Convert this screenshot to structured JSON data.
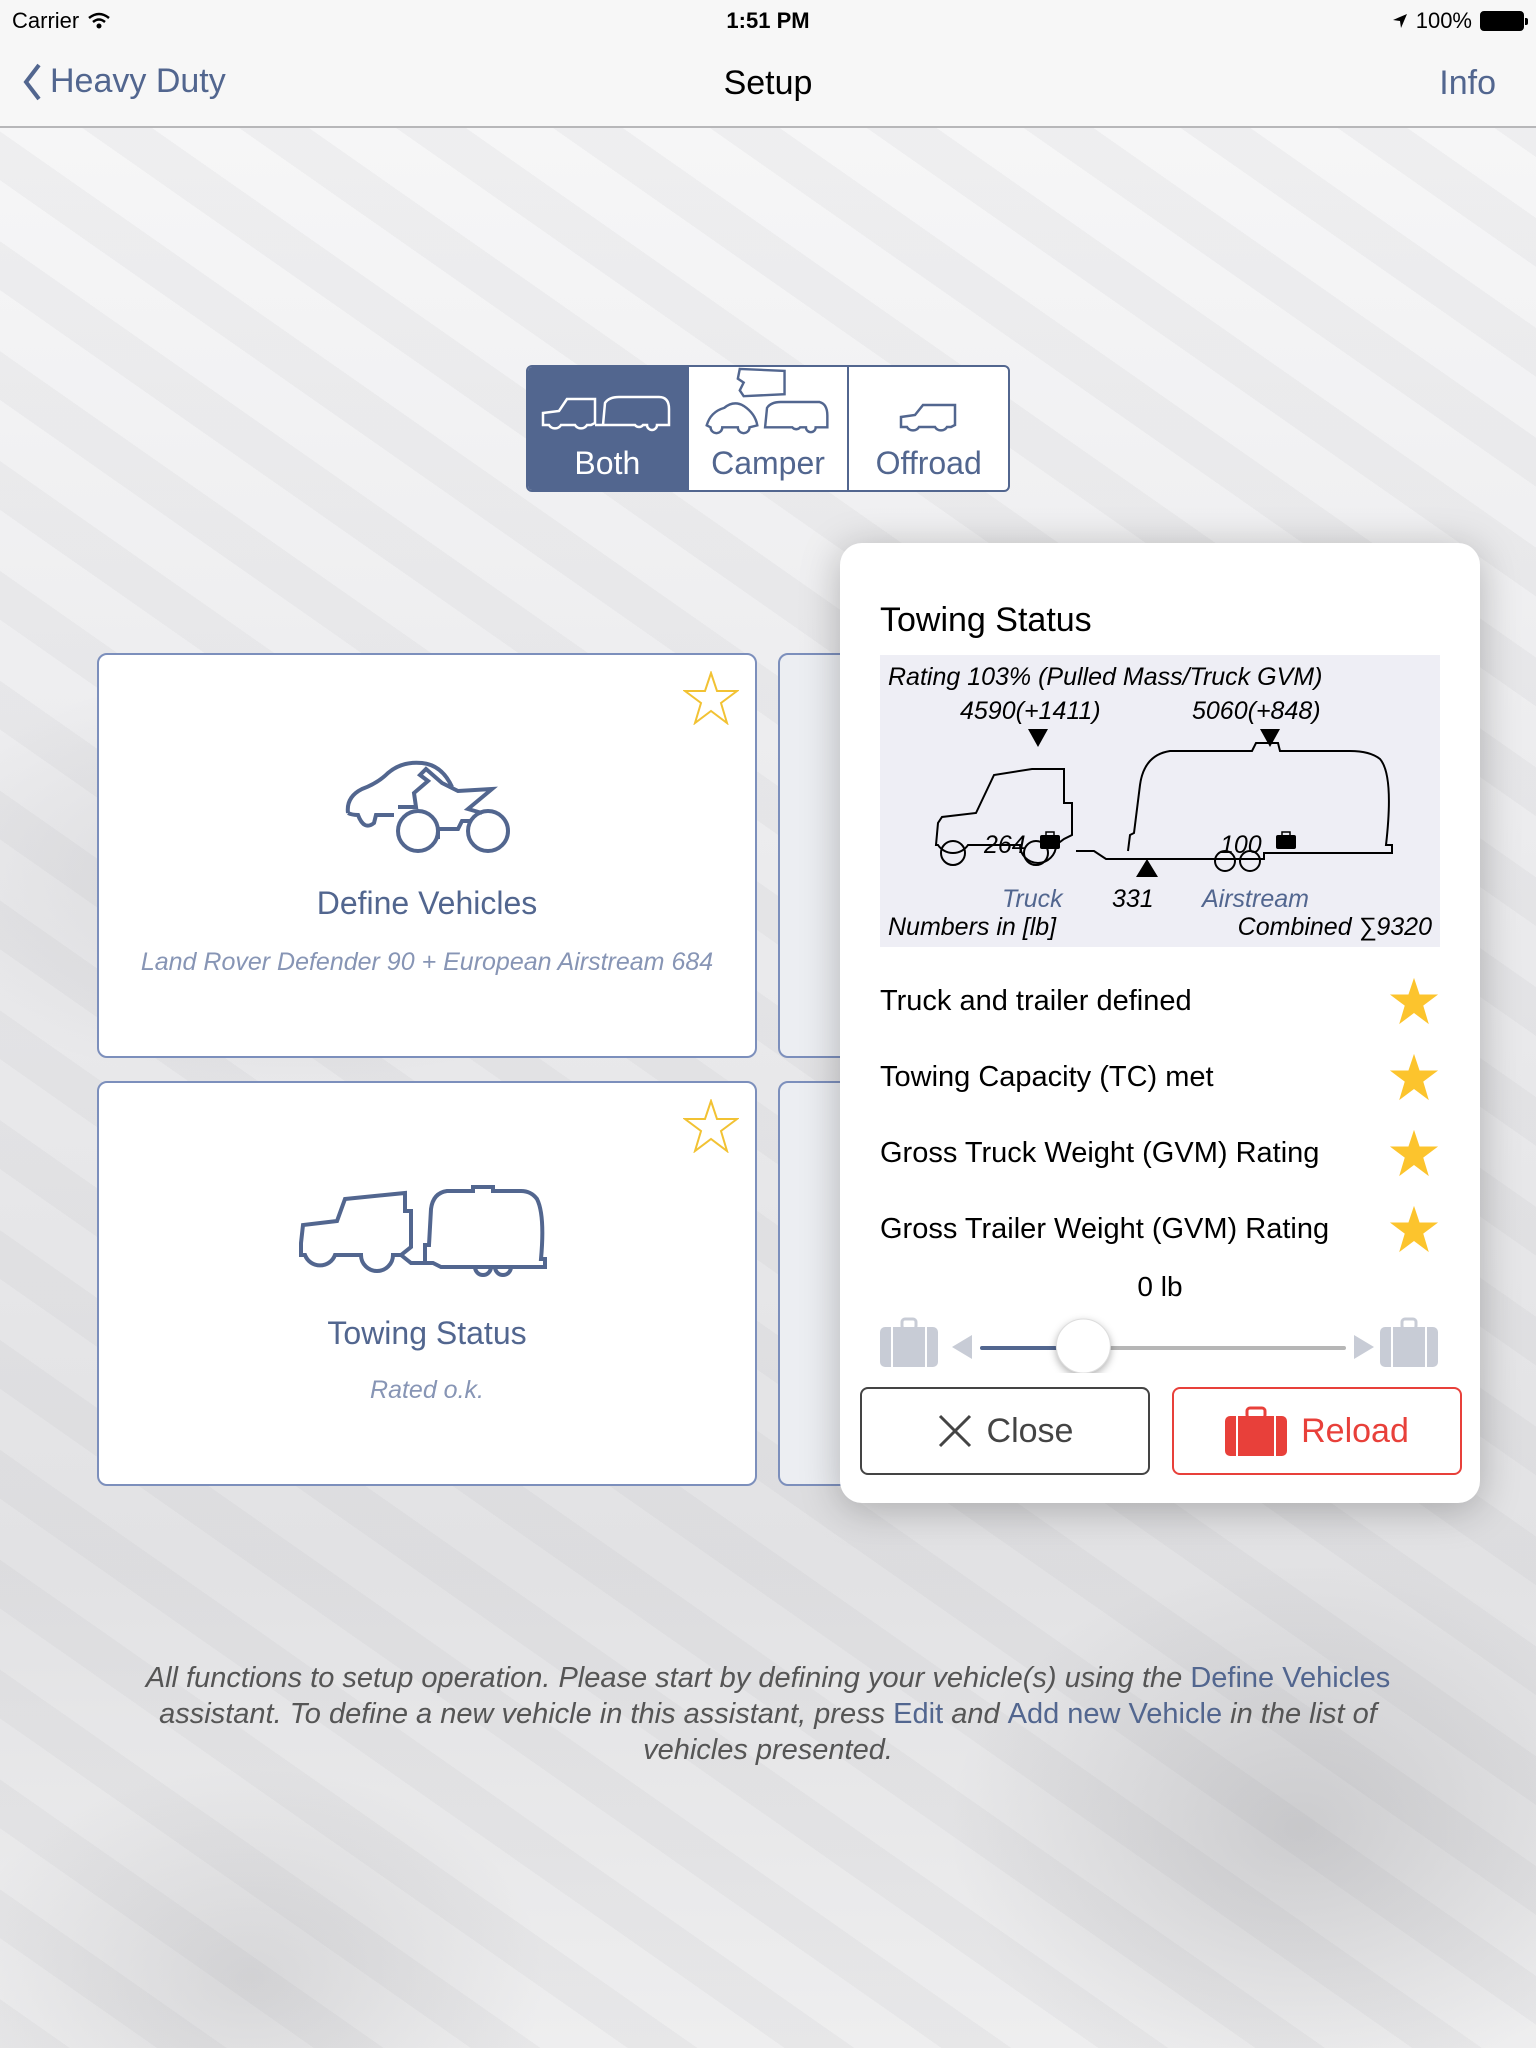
{
  "status_bar": {
    "carrier": "Carrier",
    "time": "1:51 PM",
    "battery": "100%"
  },
  "nav": {
    "back_label": "Heavy Duty",
    "title": "Setup",
    "right_label": "Info"
  },
  "segments": [
    {
      "label": "Both",
      "icon": "truck-trailer-icon",
      "selected": true
    },
    {
      "label": "Camper",
      "icon": "camper-icon",
      "selected": false
    },
    {
      "label": "Offroad",
      "icon": "offroad-icon",
      "selected": false
    }
  ],
  "cards": [
    {
      "title": "Define Vehicles",
      "subtitle": "Land Rover Defender 90 + European Airstream 684",
      "icon": "car-motorcycle-icon",
      "starred": false
    },
    {
      "title": "Towing Status",
      "subtitle": "Rated o.k.",
      "icon": "truck-trailer-icon",
      "starred": false
    }
  ],
  "popover": {
    "title": "Towing Status",
    "diagram": {
      "rating": "Rating 103% (Pulled Mass/Truck GVM)",
      "truck_weight": "4590(+1411)",
      "trailer_weight": "5060(+848)",
      "truck_load": "264",
      "trailer_load": "100",
      "tongue_weight": "331",
      "truck_label": "Truck",
      "trailer_label": "Airstream",
      "units": "Numbers in [lb]",
      "combined": "Combined ∑9320"
    },
    "checks": [
      {
        "label": "Truck and trailer defined",
        "passed": true
      },
      {
        "label": "Towing Capacity (TC) met",
        "passed": true
      },
      {
        "label": "Gross Truck Weight (GVM) Rating",
        "passed": true
      },
      {
        "label": "Gross Trailer Weight (GVM) Rating",
        "passed": true
      }
    ],
    "slider": {
      "value_label": "0 lb",
      "position_fraction": 0.28
    },
    "close_label": "Close",
    "reload_label": "Reload"
  },
  "footer": {
    "text1": "All functions to setup operation. Please start by defining your vehicle(s) using the ",
    "link1": "Define Vehicles",
    "text2": " assistant. To define a new vehicle in this assistant, press ",
    "link2": "Edit",
    "text3": " and ",
    "link3": "Add new Vehicle",
    "text4": " in the list of vehicles presented."
  },
  "colors": {
    "accent": "#52668f",
    "star": "#fcc42d",
    "reload": "#e8403a"
  }
}
